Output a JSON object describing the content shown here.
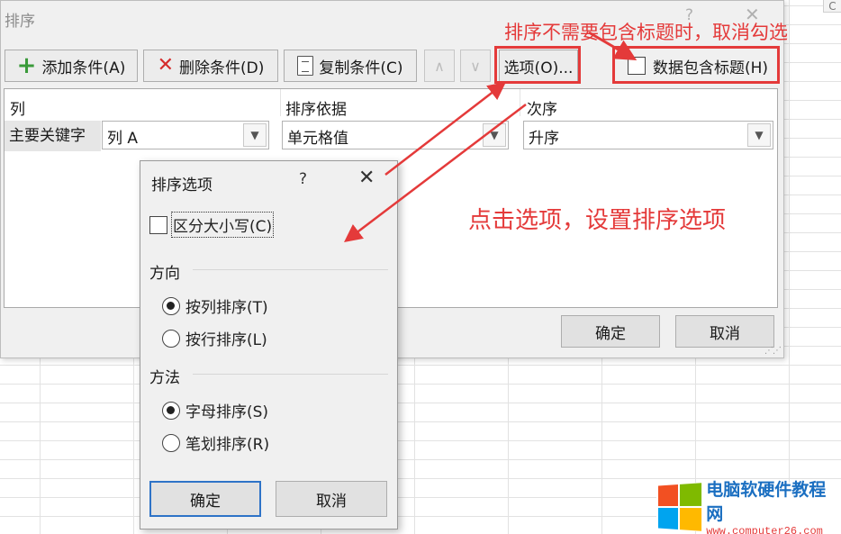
{
  "sheet": {
    "corner_text": "C"
  },
  "sort_dialog": {
    "title": "排序",
    "help": "?",
    "close": "✕",
    "toolbar": {
      "add_label": "添加条件(A)",
      "delete_label": "删除条件(D)",
      "copy_label": "复制条件(C)",
      "up": "∧",
      "down": "∨",
      "options_label": "选项(O)...",
      "header_checkbox_label": "数据包含标题(H)"
    },
    "columns": {
      "col": "列",
      "sort_on": "排序依据",
      "order": "次序"
    },
    "row": {
      "label": "主要关键字",
      "column_value": "列 A",
      "sort_on_value": "单元格值",
      "order_value": "升序"
    },
    "ok_label": "确定",
    "cancel_label": "取消"
  },
  "options_dialog": {
    "title": "排序选项",
    "help": "?",
    "close": "✕",
    "case_label": "区分大小写(C)",
    "direction_heading": "方向",
    "by_column": "按列排序(T)",
    "by_row": "按行排序(L)",
    "method_heading": "方法",
    "alphabetic": "字母排序(S)",
    "stroke": "笔划排序(R)",
    "ok_label": "确定",
    "cancel_label": "取消",
    "state": {
      "case_sensitive": false,
      "direction": "by_column",
      "method": "alphabetic"
    }
  },
  "annotations": {
    "note_top": "排序不需要包含标题时，取消勾选",
    "note_mid": "点击选项，设置排序选项",
    "accent_color": "#e43a3a"
  },
  "watermark": {
    "name": "电脑软硬件教程网",
    "url": "www.computer26.com"
  }
}
